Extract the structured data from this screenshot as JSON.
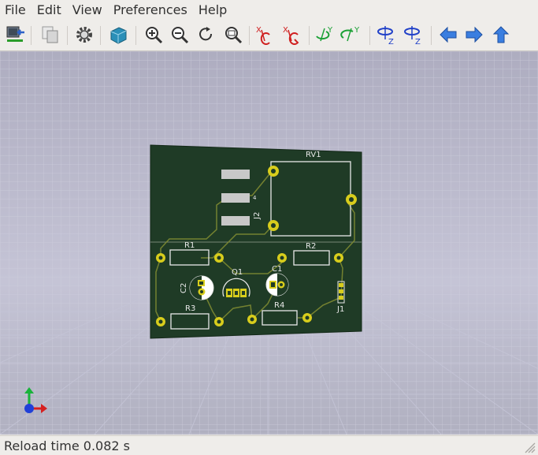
{
  "menu": [
    "File",
    "Edit",
    "View",
    "Preferences",
    "Help"
  ],
  "toolbar": {
    "icons": [
      "reload-board-icon",
      "copy-image-icon",
      "render-options-gear-icon",
      "raytracing-cube-icon",
      "zoom-in-icon",
      "zoom-out-icon",
      "redraw-icon",
      "zoom-fit-icon",
      "rotate-x-clockwise-icon",
      "rotate-x-counterclockwise-icon",
      "rotate-y-clockwise-icon",
      "rotate-y-counterclockwise-icon",
      "rotate-z-clockwise-icon",
      "rotate-z-counterclockwise-icon",
      "move-left-icon",
      "move-right-icon",
      "move-up-icon"
    ]
  },
  "board": {
    "labels": {
      "rv1": "RV1",
      "j2": "J2",
      "r1": "R1",
      "r2": "R2",
      "c2": "C2",
      "q1": "Q1",
      "c1": "C1",
      "j1": "J1",
      "r3": "R3",
      "r4": "R4",
      "pin4": "4"
    },
    "colors": {
      "board": "#1f3b26",
      "pad": "#d8cd1c",
      "silk": "#e8e8e8",
      "track": "#a39a2a"
    }
  },
  "axis": {
    "x_color": "#d62020",
    "y_color": "#19b33a",
    "z_color": "#2040d8"
  },
  "status": {
    "text": "Reload time 0.082 s"
  }
}
